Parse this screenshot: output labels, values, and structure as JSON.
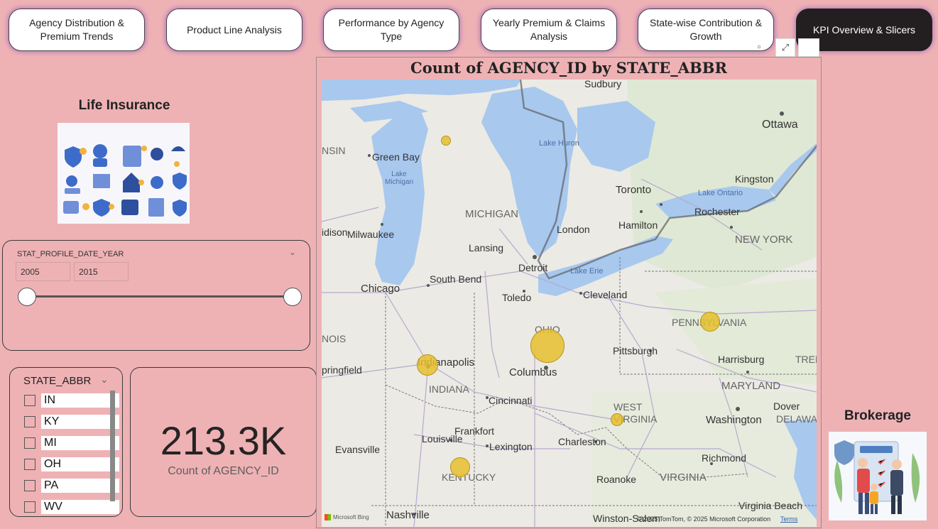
{
  "nav": {
    "tabs": [
      {
        "label": "Agency Distribution &\nPremium Trends",
        "active": false
      },
      {
        "label": "Product Line Analysis",
        "active": false
      },
      {
        "label": "Performance by Agency Type",
        "active": false
      },
      {
        "label": "Yearly Premium & Claims\nAnalysis",
        "active": false
      },
      {
        "label": "State-wise Contribution &\nGrowth",
        "active": false
      },
      {
        "label": "KPI Overview & Slicers",
        "active": true
      }
    ]
  },
  "left": {
    "life_title": "Life Insurance"
  },
  "year_slicer": {
    "title": "STAT_PROFILE_DATE_YEAR",
    "start": "2005",
    "end": "2015",
    "range_fraction": [
      0,
      1
    ]
  },
  "state_slicer": {
    "title": "STATE_ABBR",
    "items": [
      "IN",
      "KY",
      "MI",
      "OH",
      "PA",
      "WV"
    ]
  },
  "kpi": {
    "value": "213.3K",
    "label": "Count of AGENCY_ID"
  },
  "map": {
    "title": "Count of AGENCY_ID by STATE_ABBR",
    "attribution_logo": "Microsoft Bing",
    "attribution": "© 2025 TomTom, © 2025 Microsoft Corporation",
    "terms": "Terms",
    "labels": {
      "sudbury": "Sudbury",
      "ottawa": "Ottawa",
      "kingston": "Kingston",
      "toronto": "Toronto",
      "lake_ontario": "Lake Ontario",
      "rochester": "Rochester",
      "hamilton": "Hamilton",
      "london": "London",
      "new_york": "NEW YORK",
      "lake_huron": "Lake Huron",
      "green_bay": "Green Bay",
      "lake_michigan": "Lake\nMichigan",
      "nsin": "NSIN",
      "michigan": "MICHIGAN",
      "milwaukee": "Milwaukee",
      "idison": "idison",
      "lansing": "Lansing",
      "detroit": "Detroit",
      "lake_erie": "Lake Erie",
      "south_bend": "South Bend",
      "chicago": "Chicago",
      "toledo": "Toledo",
      "cleveland": "Cleveland",
      "pennsylvania": "PENNSYLVANIA",
      "ohio": "OHIO",
      "nois": "NOIS",
      "pittsburgh": "Pittsburgh",
      "indianapolis": "Indianapolis",
      "springfield": "pringfield",
      "columbus": "Columbus",
      "harrisburg": "Harrisburg",
      "tren": "TREN",
      "indiana": "INDIANA",
      "maryland": "MARYLAND",
      "cincinnati": "Cincinnati",
      "west_virginia": "WEST\nVIRGINIA",
      "dover": "Dover",
      "washington": "Washington",
      "delawa": "DELAWA",
      "frankfort": "Frankfort",
      "louisville": "Louisville",
      "evansville": "Evansville",
      "charleston": "Charleston",
      "lexington": "Lexington",
      "richmond": "Richmond",
      "kentucky": "KENTUCKY",
      "roanoke": "Roanoke",
      "virginia": "VIRGINIA",
      "nashville": "Nashville",
      "virginia_beach": "Virginia Beach",
      "winston": "Winston-Salem"
    }
  },
  "right": {
    "brokerage_title": "Brokerage"
  },
  "colors": {
    "background": "#eeb2b5",
    "bubble": "#e6bf2e",
    "water": "#a8c8ee",
    "active_tab": "#231f20"
  }
}
